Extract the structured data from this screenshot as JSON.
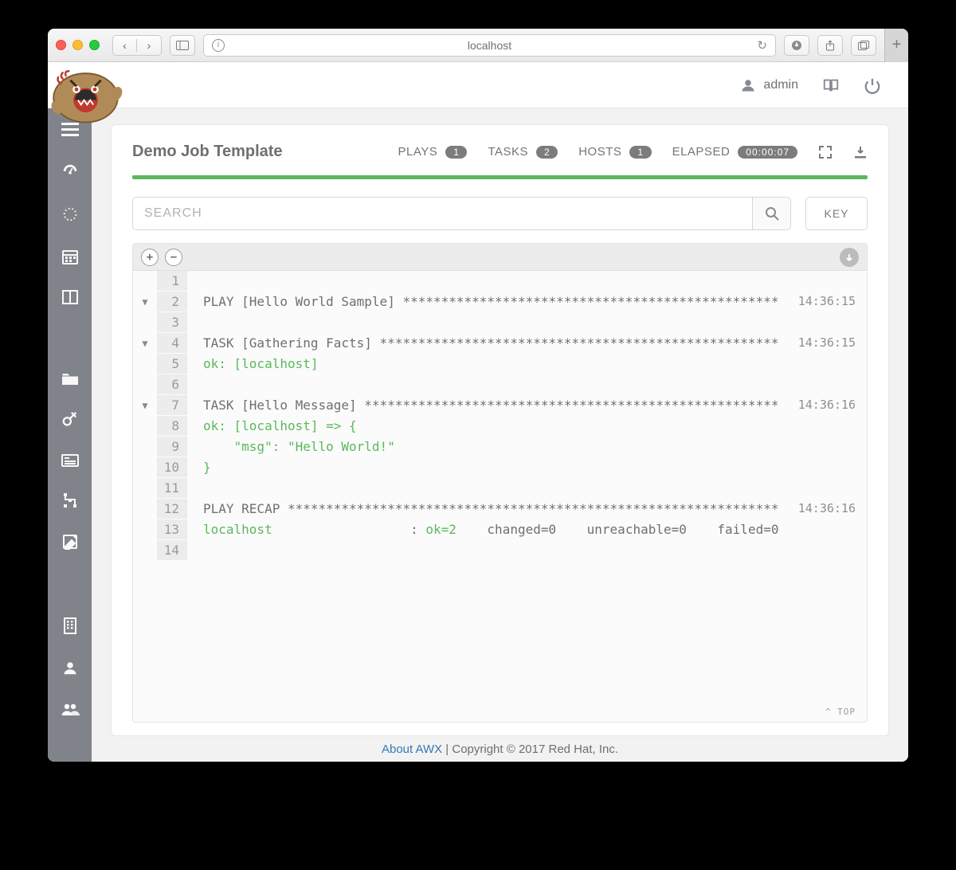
{
  "browser": {
    "address": "localhost"
  },
  "topbar": {
    "username": "admin"
  },
  "job": {
    "title": "Demo Job Template",
    "plays_label": "PLAYS",
    "plays_count": "1",
    "tasks_label": "TASKS",
    "tasks_count": "2",
    "hosts_label": "HOSTS",
    "hosts_count": "1",
    "elapsed_label": "ELAPSED",
    "elapsed_value": "00:00:07"
  },
  "search": {
    "placeholder": "SEARCH",
    "key_label": "KEY"
  },
  "console": {
    "top_label": "^ TOP",
    "lines": {
      "l1": "",
      "l2": "PLAY [Hello World Sample] *************************************************",
      "l3": "",
      "l4": "TASK [Gathering Facts] ****************************************************",
      "l5": "ok: [localhost]",
      "l6": "",
      "l7": "TASK [Hello Message] ******************************************************",
      "l8": "ok: [localhost] => {",
      "l9": "    \"msg\": \"Hello World!\"",
      "l10": "}",
      "l11": "",
      "l12": "PLAY RECAP ****************************************************************",
      "l13_host": "localhost",
      "l13_ok": "ok=2",
      "l13_rest": "    changed=0    unreachable=0    failed=0",
      "l14": ""
    },
    "ts": {
      "t2": "14:36:15",
      "t4": "14:36:15",
      "t7": "14:36:16",
      "t12": "14:36:16"
    }
  },
  "footer": {
    "about": "About AWX",
    "copyright": "Copyright © 2017 Red Hat, Inc."
  }
}
